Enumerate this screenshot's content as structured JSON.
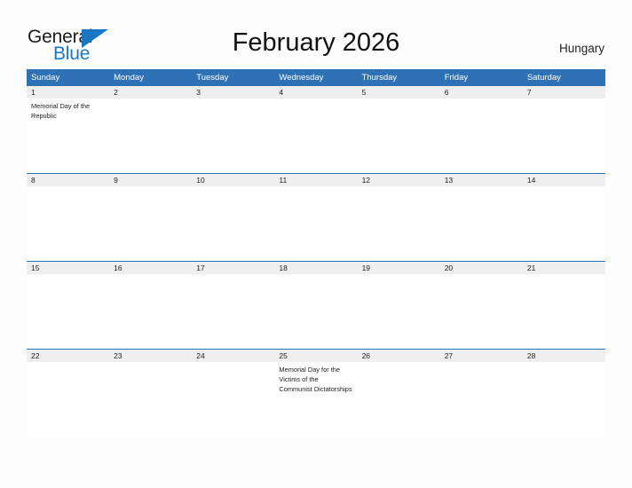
{
  "logo": {
    "word1": "General",
    "word2": "Blue",
    "triangle_color": "#1b76c4",
    "word1_color": "#1b1b1b",
    "word2_color": "#1b76c4"
  },
  "header": {
    "title": "February 2026",
    "country": "Hungary"
  },
  "theme": {
    "header_blue": "#2f71b5",
    "date_band_gray": "#efefef",
    "page_background": "#fdfdfd",
    "text_color": "#1d1d1d"
  },
  "calendar": {
    "weekdays": [
      "Sunday",
      "Monday",
      "Tuesday",
      "Wednesday",
      "Thursday",
      "Friday",
      "Saturday"
    ],
    "weeks": [
      [
        {
          "date": "1",
          "events": [
            "Memorial Day of the Republic"
          ]
        },
        {
          "date": "2",
          "events": []
        },
        {
          "date": "3",
          "events": []
        },
        {
          "date": "4",
          "events": []
        },
        {
          "date": "5",
          "events": []
        },
        {
          "date": "6",
          "events": []
        },
        {
          "date": "7",
          "events": []
        }
      ],
      [
        {
          "date": "8",
          "events": []
        },
        {
          "date": "9",
          "events": []
        },
        {
          "date": "10",
          "events": []
        },
        {
          "date": "11",
          "events": []
        },
        {
          "date": "12",
          "events": []
        },
        {
          "date": "13",
          "events": []
        },
        {
          "date": "14",
          "events": []
        }
      ],
      [
        {
          "date": "15",
          "events": []
        },
        {
          "date": "16",
          "events": []
        },
        {
          "date": "17",
          "events": []
        },
        {
          "date": "18",
          "events": []
        },
        {
          "date": "19",
          "events": []
        },
        {
          "date": "20",
          "events": []
        },
        {
          "date": "21",
          "events": []
        }
      ],
      [
        {
          "date": "22",
          "events": []
        },
        {
          "date": "23",
          "events": []
        },
        {
          "date": "24",
          "events": []
        },
        {
          "date": "25",
          "events": [
            "Memorial Day for the Victims of the Communist Dictatorships"
          ]
        },
        {
          "date": "26",
          "events": []
        },
        {
          "date": "27",
          "events": []
        },
        {
          "date": "28",
          "events": []
        }
      ]
    ]
  }
}
